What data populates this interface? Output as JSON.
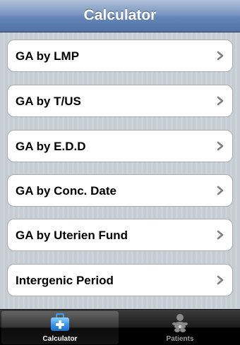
{
  "navbar": {
    "title": "Calculator"
  },
  "list": {
    "items": [
      {
        "label": "GA by LMP"
      },
      {
        "label": "GA by T/US"
      },
      {
        "label": "GA by E.D.D"
      },
      {
        "label": "GA by Conc. Date"
      },
      {
        "label": "GA by Uterien Fund"
      },
      {
        "label": "Intergenic Period"
      }
    ],
    "chevron_icon": "chevron-right-icon"
  },
  "tabbar": {
    "tabs": [
      {
        "label": "Calculator",
        "icon": "medical-kit-icon",
        "selected": true
      },
      {
        "label": "Patients",
        "icon": "baby-icon",
        "selected": false
      }
    ]
  },
  "colors": {
    "nav_bar": "#6485b6",
    "tab_active_icon": "#3a9bf0",
    "tab_inactive_icon": "#8a8a8a",
    "chevron": "#7f7f7f"
  }
}
